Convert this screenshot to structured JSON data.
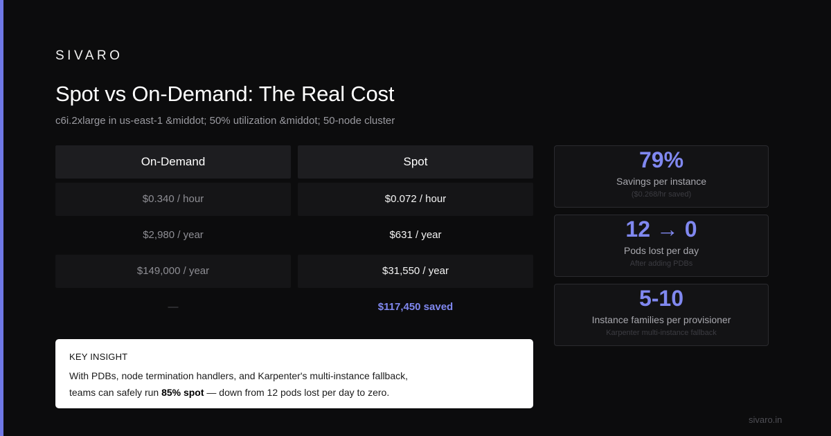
{
  "colors": {
    "accent": "#6f78e6",
    "stat_value": "#8088f0",
    "background": "#0c0c0d",
    "insight_background": "#ffffff"
  },
  "brand": "SIVARO",
  "title": "Spot vs On-Demand: The Real Cost",
  "subtitle": "c6i.2xlarge in us-east-1 &middot; 50% utilization &middot; 50-node cluster",
  "comparison": {
    "headers": {
      "on_demand": "On-Demand",
      "spot": "Spot"
    },
    "rows": [
      {
        "on_demand": "$0.340 / hour",
        "spot": "$0.072 / hour"
      },
      {
        "on_demand": "$2,980 / year",
        "spot": "$631 / year"
      },
      {
        "on_demand": "$149,000 / year",
        "spot": "$31,550 / year"
      },
      {
        "on_demand": "—",
        "spot": "$117,450 saved"
      }
    ]
  },
  "stats": [
    {
      "value": "79%",
      "label": "Savings per instance",
      "note": "($0.268/hr saved)"
    },
    {
      "value": "12 → 0",
      "label": "Pods lost per day",
      "note": "After adding PDBs"
    },
    {
      "value": "5-10",
      "label": "Instance families per provisioner",
      "note": "Karpenter multi-instance fallback"
    }
  ],
  "insight": {
    "title": "KEY INSIGHT",
    "line1": "With PDBs, node termination handlers, and Karpenter's multi-instance fallback,",
    "line2_before": "teams can safely run ",
    "line2_bold": "85% spot",
    "line2_after": " — down from 12 pods lost per day to zero."
  },
  "footer": "sivaro.in"
}
